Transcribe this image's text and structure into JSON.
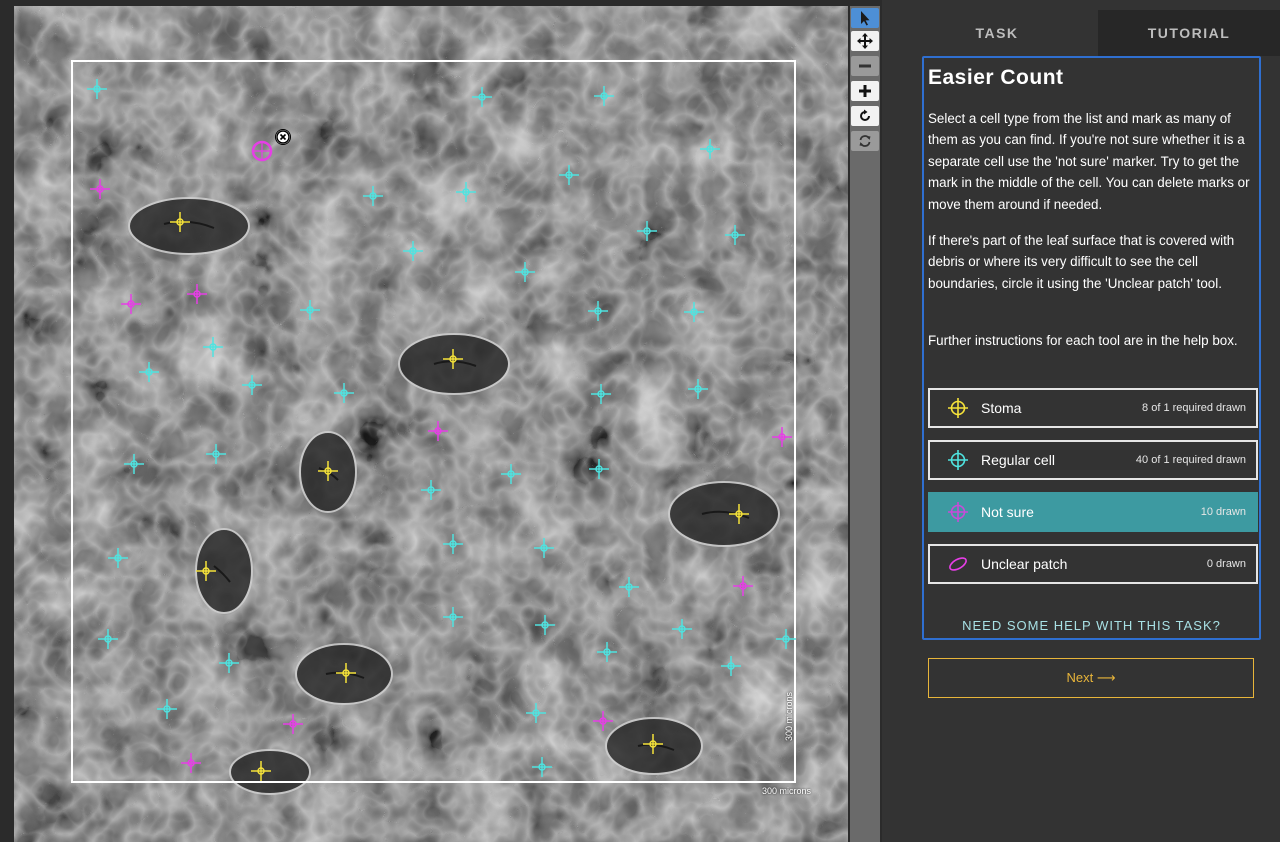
{
  "viewer": {
    "scale_label_bottom": "300 microns",
    "scale_label_side": "300 microns",
    "colors": {
      "stoma": "#f5e23a",
      "regular": "#4fe3e0",
      "not_sure": "#e63ee6"
    }
  },
  "toolbar": {
    "select_icon": "pointer-icon",
    "pan_icon": "move-icon",
    "zoom_out_icon": "minus-icon",
    "zoom_in_icon": "plus-icon",
    "rotate_icon": "rotate-icon",
    "reset_icon": "refresh-icon"
  },
  "tabs": {
    "task": "TASK",
    "tutorial": "TUTORIAL"
  },
  "task": {
    "title": "Easier Count",
    "paragraphs": [
      "Select a cell type from the list and mark as many of them as you can find. If you're not sure whether it is a separate cell use the 'not sure' marker. Try to get the mark in the middle of the cell. You can delete marks or move them around if needed.",
      "If there's part of the leaf surface that is covered with debris or where its very difficult to see the cell boundaries, circle it using the 'Unclear patch' tool.",
      "Further instructions for each tool are in the help box."
    ],
    "tools": [
      {
        "label": "Stoma",
        "count": "8 of 1 required drawn",
        "color": "#f5e23a",
        "icon": "crosshair-icon"
      },
      {
        "label": "Regular cell",
        "count": "40 of 1 required drawn",
        "color": "#4fe3e0",
        "icon": "crosshair-icon"
      },
      {
        "label": "Not sure",
        "count": "10 drawn",
        "color": "#c84bd8",
        "icon": "crosshair-icon"
      },
      {
        "label": "Unclear patch",
        "count": "0 drawn",
        "color": "#e63ee6",
        "icon": "ellipse-icon"
      }
    ],
    "help_link": "NEED SOME HELP WITH THIS TASK?",
    "next_button": "Next ⟶"
  }
}
